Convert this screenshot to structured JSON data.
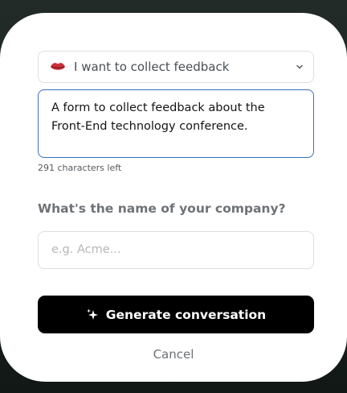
{
  "form": {
    "goal_select": {
      "icon": "lips-icon",
      "selected_value": "I want to collect feedback",
      "chevron_icon": "chevron-down-icon"
    },
    "description": {
      "value": "A form to collect feedback about the Front-End technology conference.",
      "characters_left": "291 characters left"
    },
    "company": {
      "question": "What's the name of your company?",
      "placeholder": "e.g. Acme..."
    },
    "generate_button": {
      "icon": "sparkle-icon",
      "label": "Generate conversation"
    },
    "cancel_label": "Cancel"
  },
  "colors": {
    "accent_focus_border": "#3b6cc7",
    "primary_button_bg": "#000000",
    "muted_text": "#6e7276",
    "backdrop": "#1b2320"
  }
}
